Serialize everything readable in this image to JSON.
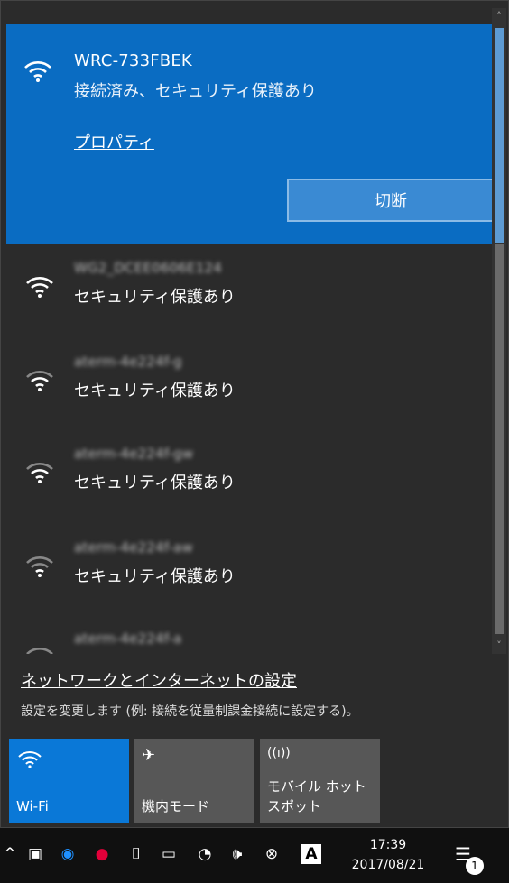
{
  "connected": {
    "ssid": "WRC-733FBEK",
    "status": "接続済み、セキュリティ保護あり",
    "properties_label": "プロパティ",
    "disconnect_label": "切断"
  },
  "networks": [
    {
      "ssid": "WG2_DCEE0606E124",
      "status": "セキュリティ保護あり"
    },
    {
      "ssid": "aterm-4e224f-g",
      "status": "セキュリティ保護あり"
    },
    {
      "ssid": "aterm-4e224f-gw",
      "status": "セキュリティ保護あり"
    },
    {
      "ssid": "aterm-4e224f-aw",
      "status": "セキュリティ保護あり"
    },
    {
      "ssid": "aterm-4e224f-a",
      "status": ""
    }
  ],
  "settings": {
    "link_label": "ネットワークとインターネットの設定",
    "subtitle": "設定を変更します (例: 接続を従量制課金接続に設定する)。"
  },
  "tiles": [
    {
      "label": "Wi-Fi",
      "icon": "wifi-icon",
      "active": true
    },
    {
      "label": "機内モード",
      "icon": "airplane-icon",
      "active": false
    },
    {
      "label": "モバイル ホットスポット",
      "icon": "hotspot-icon",
      "active": false
    }
  ],
  "taskbar": {
    "time": "17:39",
    "date": "2017/08/21",
    "notification_count": "1"
  },
  "colors": {
    "accent": "#0a6cc2",
    "flyout_bg": "#2b2b2b",
    "tile_bg": "#575757",
    "tile_active": "#0a78d7"
  }
}
